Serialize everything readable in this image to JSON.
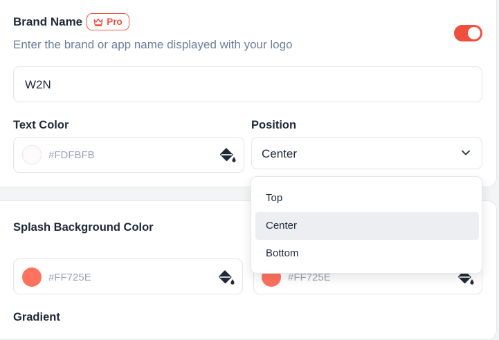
{
  "brand": {
    "title": "Brand Name",
    "badge": "Pro",
    "subtitle": "Enter the brand or app name displayed with your logo",
    "toggle_on": true,
    "value": "W2N"
  },
  "text_color": {
    "label": "Text Color",
    "hex": "#FDFBFB",
    "swatch": "#FDFBFB"
  },
  "position": {
    "label": "Position",
    "selected": "Center",
    "options": [
      "Top",
      "Center",
      "Bottom"
    ]
  },
  "splash": {
    "label": "Splash Background Color",
    "hex_1": "#FF725E",
    "swatch_1": "#FF725E",
    "hex_2": "#FF725E",
    "swatch_2": "#FF725E"
  },
  "gradient": {
    "label": "Gradient"
  },
  "colors": {
    "accent": "#EF4F3D"
  }
}
